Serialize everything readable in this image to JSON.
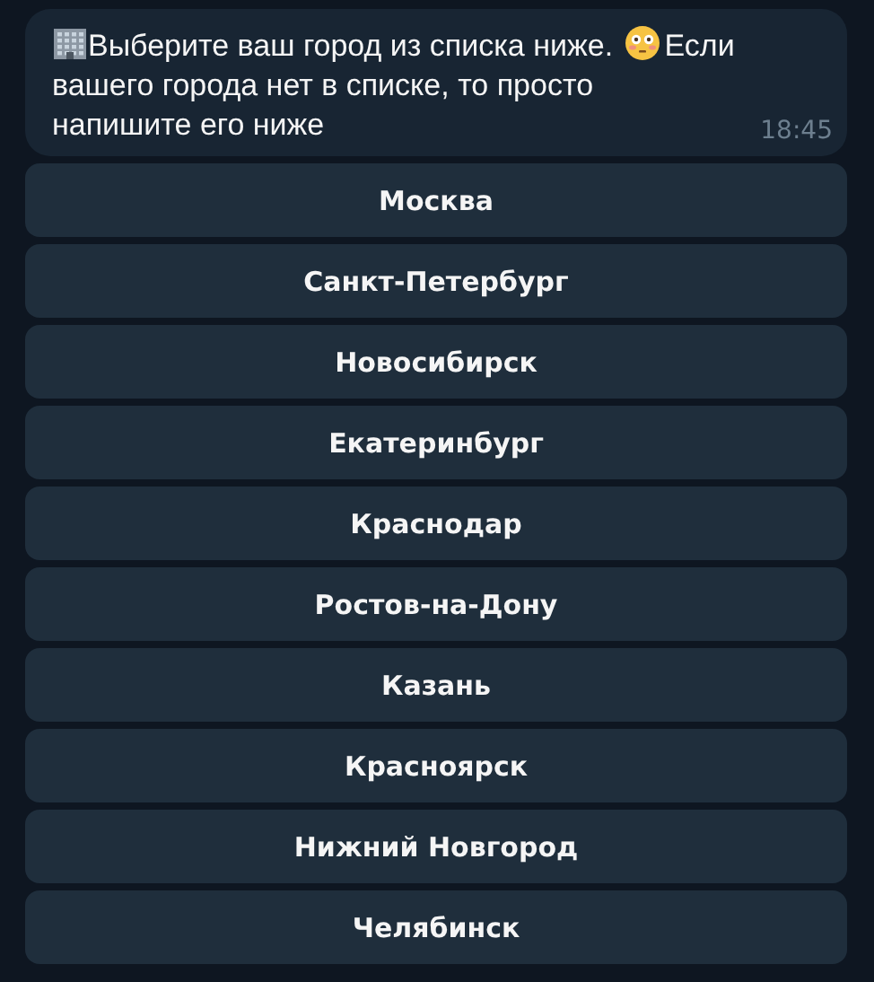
{
  "message": {
    "text_parts": [
      {
        "kind": "building"
      },
      {
        "kind": "text",
        "text": "Выберите ваш город из списка ниже. "
      },
      {
        "kind": "face"
      },
      {
        "kind": "text",
        "text": "Если"
      },
      {
        "kind": "block",
        "text": "вашего города нет в списке, то просто напишите его ниже"
      }
    ],
    "time": "18:45"
  },
  "buttons": [
    {
      "label": "Москва"
    },
    {
      "label": "Санкт-Петербург"
    },
    {
      "label": "Новосибирск"
    },
    {
      "label": "Екатеринбург"
    },
    {
      "label": "Краснодар"
    },
    {
      "label": "Ростов-на-Дону"
    },
    {
      "label": "Казань"
    },
    {
      "label": "Красноярск"
    },
    {
      "label": "Нижний Новгород"
    },
    {
      "label": "Челябинск"
    }
  ]
}
